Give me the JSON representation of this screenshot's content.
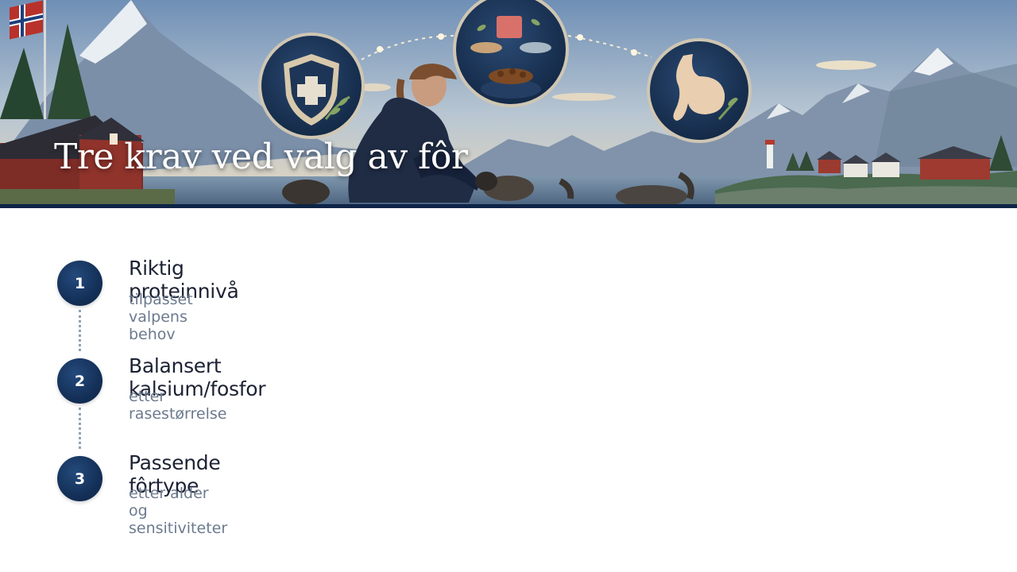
{
  "banner": {
    "title": "Tre krav ved valg av fôr",
    "icons": [
      "shield-cross-icon",
      "food-bowl-icon",
      "stomach-icon",
      "norwegian-flag-icon"
    ]
  },
  "steps": [
    {
      "number": "1",
      "title": "Riktig proteinnivå",
      "subtitle": "tilpasset valpens behov"
    },
    {
      "number": "2",
      "title": "Balansert kalsium/fosfor",
      "subtitle": "etter rasestørrelse"
    },
    {
      "number": "3",
      "title": "Passende fôrtype",
      "subtitle": "etter alder og sensitiviteter"
    }
  ],
  "colors": {
    "accent_navy": "#143058",
    "title_text": "#1b2233",
    "subtitle_text": "#6c7a8e",
    "banner_border": "#0e2447"
  }
}
